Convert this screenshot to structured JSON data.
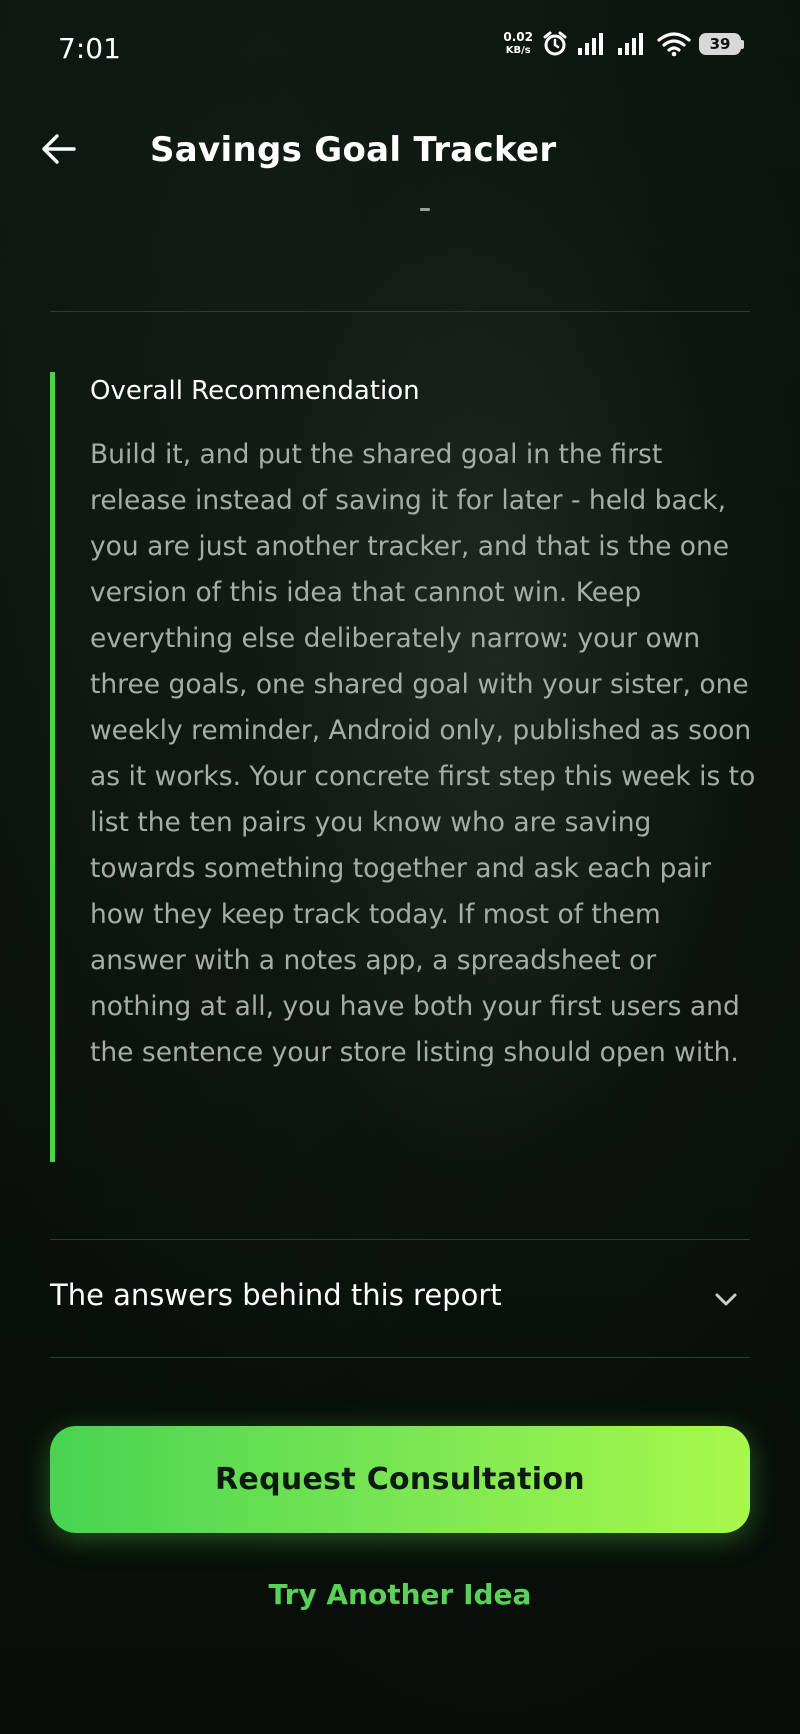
{
  "status_bar": {
    "time": "7:01",
    "net_speed_value": "0.02",
    "net_speed_unit": "KB/s",
    "battery_level": "39",
    "icons": [
      "alarm-icon",
      "signal-icon",
      "signal-icon",
      "wifi-icon",
      "battery-icon"
    ]
  },
  "header": {
    "back_icon": "arrow-left-icon",
    "title": "Savings Goal Tracker"
  },
  "recommendation": {
    "accent_color": "#4fd04f",
    "title": "Overall Recommendation",
    "body": "Build it, and put the shared goal in the first release instead of saving it for later - held back, you are just another tracker, and that is the one version of this idea that cannot win. Keep everything else deliberately narrow: your own three goals, one shared goal with your sister, one weekly reminder, Android only, published as soon as it works. Your concrete first step this week is to list the ten pairs you know who are saving towards something together and ask each pair how they keep track today. If most of them answer with a notes app, a spreadsheet or nothing at all, you have both your first users and the sentence your store listing should open with."
  },
  "accordion": {
    "label": "The answers behind this report",
    "icon": "chevron-down-icon",
    "expanded": false
  },
  "actions": {
    "primary_label": "Request Consultation",
    "secondary_label": "Try Another Idea",
    "primary_gradient": [
      "#47d451",
      "#a8f94a"
    ],
    "link_color": "#58d358"
  }
}
